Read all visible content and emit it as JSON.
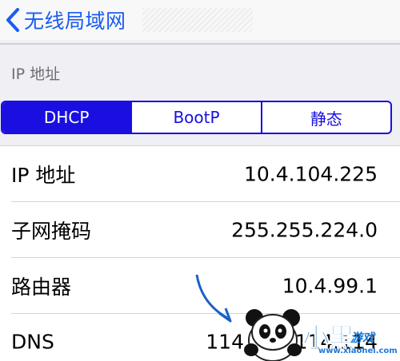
{
  "nav": {
    "back_label": "无线局域网"
  },
  "section": {
    "header": "IP 地址"
  },
  "segmented": {
    "items": [
      {
        "label": "DHCP",
        "selected": true
      },
      {
        "label": "BootP",
        "selected": false
      },
      {
        "label": "静态",
        "selected": false
      }
    ]
  },
  "rows": [
    {
      "label": "IP 地址",
      "value": "10.4.104.225"
    },
    {
      "label": "子网掩码",
      "value": "255.255.224.0"
    },
    {
      "label": "路由器",
      "value": "10.4.99.1"
    },
    {
      "label": "DNS",
      "value": "114.114.114.114"
    }
  ],
  "watermark": {
    "brand_big": "小黑",
    "brand_small": "游戏",
    "url": "www.xiaohei.com"
  },
  "colors": {
    "accent": "#1a0fe0",
    "nav_link": "#1a5cf0",
    "background": "#efeff4",
    "watermark": "#1b7ad8"
  },
  "icons": {
    "back": "chevron-left-icon"
  }
}
